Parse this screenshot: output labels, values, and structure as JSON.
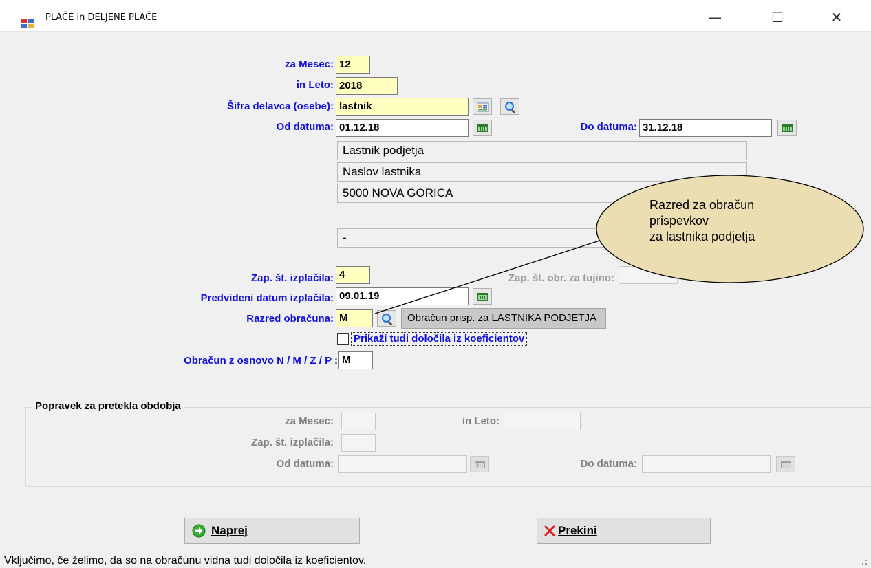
{
  "window": {
    "title": "PLAČE in DELJENE PLAČE",
    "minimize_glyph": "—",
    "maximize_glyph": "☐",
    "close_glyph": "✕"
  },
  "form": {
    "mesec_label": "za Mesec:",
    "mesec_value": "12",
    "leto_label": "in Leto:",
    "leto_value": "2018",
    "sifra_label": "Šifra delavca (osebe):",
    "sifra_value": "lastnik",
    "od_label": "Od datuma:",
    "od_value": "01.12.18",
    "do_label": "Do datuma:",
    "do_value": "31.12.18",
    "info_lines": [
      "Lastnik podjetja",
      "Naslov lastnika",
      "5000 NOVA GORICA"
    ],
    "extra_line": "-",
    "zap_label": "Zap. št. izplačila:",
    "zap_value": "4",
    "tujino_label": "Zap. št. obr. za tujino:",
    "tujino_value": "",
    "pred_label": "Predvideni datum izplačila:",
    "pred_value": "09.01.19",
    "razred_label": "Razred obračuna:",
    "razred_value": "M",
    "razred_desc": "Obračun prisp. za LASTNIKA PODJETJA",
    "checkbox_label": "Prikaži tudi določila iz koeficientov",
    "checkbox_checked": false,
    "osnovo_label": "Obračun z osnovo N / M / Z / P :",
    "osnovo_value": "M"
  },
  "correction": {
    "title": "Popravek za pretekla obdobja",
    "mesec_label": "za Mesec:",
    "leto_label": "in Leto:",
    "zap_label": "Zap. št. izplačila:",
    "od_label": "Od datuma:",
    "do_label": "Do datuma:"
  },
  "buttons": {
    "naprej": "Naprej",
    "prekini": "Prekini"
  },
  "callout": {
    "text": "Razred za obračun\nprispevkov\nza lastnika podjetja"
  },
  "statusbar": {
    "text": "Vključimo, če želimo, da so na obračunu vidna tudi določila iz koeficientov."
  },
  "colors": {
    "label_blue": "#1010dd",
    "field_yellow": "#ffffc0",
    "callout_fill": "#ecdeb3"
  }
}
